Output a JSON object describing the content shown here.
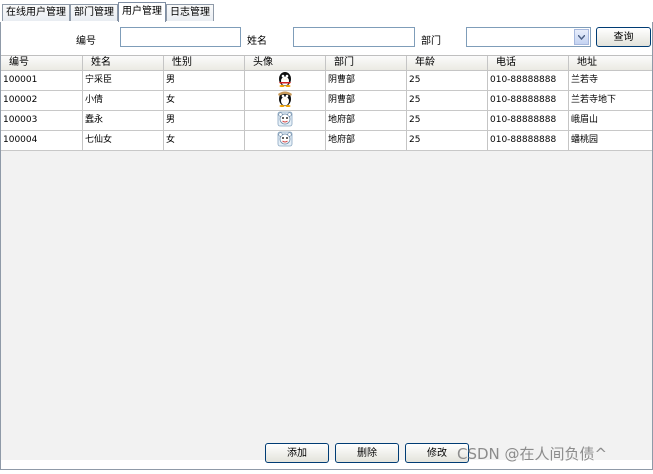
{
  "tabs": [
    {
      "label": "在线用户管理"
    },
    {
      "label": "部门管理"
    },
    {
      "label": "用户管理"
    },
    {
      "label": "日志管理"
    }
  ],
  "active_tab": "用户管理",
  "search": {
    "id_label": "编号",
    "id_value": "",
    "name_label": "姓名",
    "name_value": "",
    "dept_label": "部门",
    "dept_value": "",
    "query_label": "查询"
  },
  "table": {
    "columns": [
      "编号",
      "姓名",
      "性别",
      "头像",
      "部门",
      "年龄",
      "电话",
      "地址"
    ],
    "rows": [
      {
        "id": "100001",
        "name": "宁采臣",
        "gender": "男",
        "avatar": "penguin-avatar-icon",
        "dept": "阴曹部",
        "age": "25",
        "phone": "010-88888888",
        "address": "兰若寺"
      },
      {
        "id": "100002",
        "name": "小倩",
        "gender": "女",
        "avatar": "penguin-avatar-icon",
        "dept": "阴曹部",
        "age": "25",
        "phone": "010-88888888",
        "address": "兰若寺地下"
      },
      {
        "id": "100003",
        "name": "蠢永",
        "gender": "男",
        "avatar": "cartoon-avatar-icon",
        "dept": "地府部",
        "age": "25",
        "phone": "010-88888888",
        "address": "峨眉山"
      },
      {
        "id": "100004",
        "name": "七仙女",
        "gender": "女",
        "avatar": "cartoon-avatar-icon",
        "dept": "地府部",
        "age": "25",
        "phone": "010-88888888",
        "address": "蟠桃园"
      }
    ]
  },
  "actions": {
    "add_label": "添加",
    "delete_label": "删除",
    "modify_label": "修改"
  },
  "watermark": "CSDN @在人间负债^"
}
